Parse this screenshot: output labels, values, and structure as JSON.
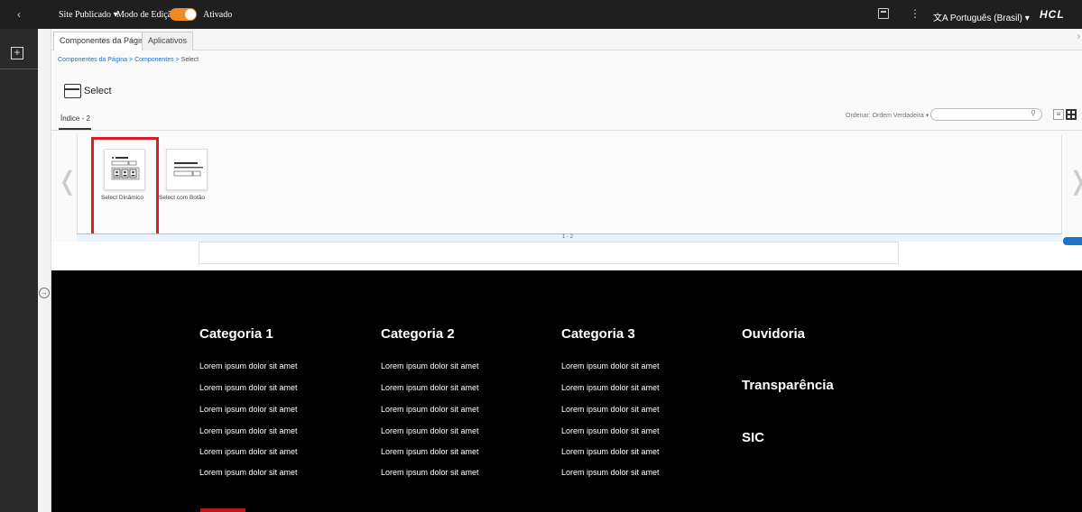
{
  "topbar": {
    "back_icon": "chevron-left-icon",
    "site_label": "Site Publicado",
    "site_caret": "▾",
    "mode_label": "Modo de Edição:",
    "mode_state": "Ativado",
    "mode_on": true,
    "accent": "#f08a24",
    "language": "Português (Brasil)",
    "brand": "HCL"
  },
  "panel": {
    "tabs": [
      {
        "label": "Componentes da Página",
        "active": true
      },
      {
        "label": "Aplicativos",
        "active": false
      }
    ],
    "breadcrumb": {
      "parts": [
        "Componentes da Página",
        "Componentes"
      ],
      "separator": ">",
      "current": "Select"
    },
    "title": "Select",
    "index_label": "Índice - 2",
    "sort_label": "Ordenar: Ordem Verdadeira",
    "search_placeholder": "",
    "items": [
      {
        "label": "Select Dinâmico",
        "selected": true
      },
      {
        "label": "Select com Botão",
        "selected": false
      }
    ],
    "pager": "1 - 2",
    "highlight_color": "#d62027"
  },
  "footer": {
    "columns": [
      {
        "heading": "Categoria 1",
        "items": [
          "Lorem ipsum dolor sit amet",
          "Lorem ipsum dolor sit amet",
          "Lorem ipsum dolor sit amet",
          "Lorem ipsum dolor sit amet",
          "Lorem ipsum dolor sit amet",
          "Lorem ipsum dolor sit amet"
        ]
      },
      {
        "heading": "Categoria 2",
        "items": [
          "Lorem ipsum dolor sit amet",
          "Lorem ipsum dolor sit amet",
          "Lorem ipsum dolor sit amet",
          "Lorem ipsum dolor sit amet",
          "Lorem ipsum dolor sit amet",
          "Lorem ipsum dolor sit amet"
        ]
      },
      {
        "heading": "Categoria 3",
        "items": [
          "Lorem ipsum dolor sit amet",
          "Lorem ipsum dolor sit amet",
          "Lorem ipsum dolor sit amet",
          "Lorem ipsum dolor sit amet",
          "Lorem ipsum dolor sit amet",
          "Lorem ipsum dolor sit amet"
        ]
      }
    ],
    "links": [
      "Ouvidoria",
      "Transparência",
      "SIC"
    ]
  }
}
